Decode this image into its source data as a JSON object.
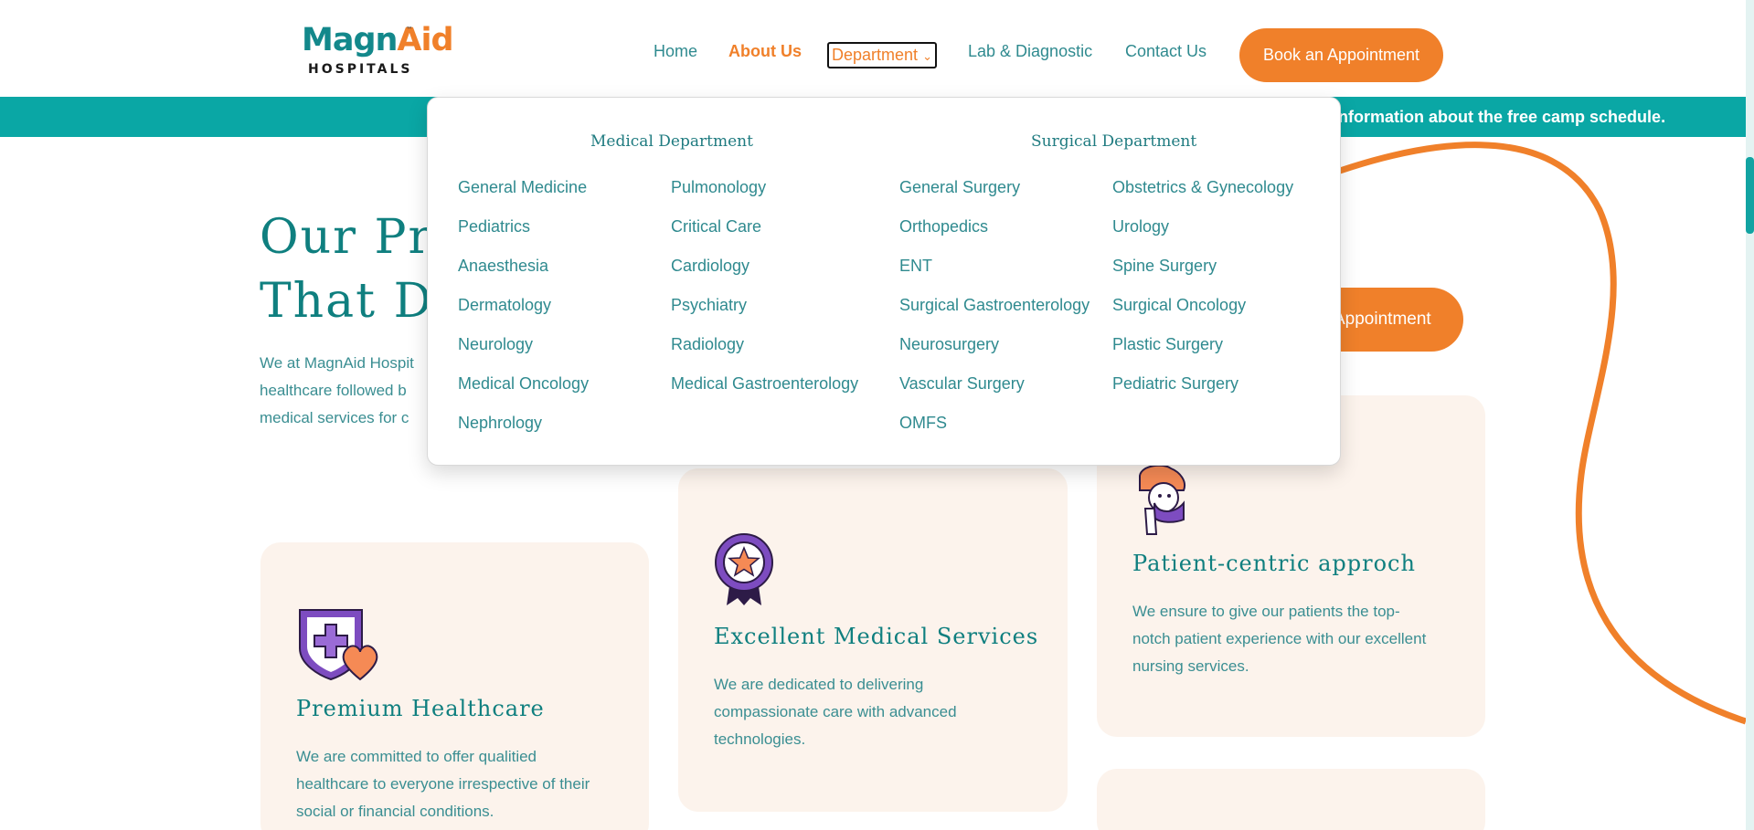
{
  "brand": {
    "name_part1": "Magn",
    "name_part2": "Aid",
    "trademark": "™",
    "subtitle": "HOSPITALS"
  },
  "nav": {
    "home": "Home",
    "about": "About Us",
    "department": "Department",
    "department_caret": "⌄",
    "lab": "Lab & Diagnostic",
    "contact": "Contact Us",
    "book": "Book an Appointment"
  },
  "banner": {
    "text": "r information about the free camp schedule."
  },
  "dropdown": {
    "medical_heading": "Medical Department",
    "surgical_heading": "Surgical Department",
    "medical_col1": [
      "General Medicine",
      "Pediatrics",
      "Anaesthesia",
      "Dermatology",
      "Neurology",
      "Medical Oncology",
      "Nephrology"
    ],
    "medical_col2": [
      "Pulmonology",
      "Critical Care",
      "Cardiology",
      "Psychiatry",
      "Radiology",
      "Medical Gastroenterology"
    ],
    "surgical_col1": [
      "General Surgery",
      "Orthopedics",
      "ENT",
      "Surgical Gastroenterology",
      "Neurosurgery",
      "Vascular Surgery",
      "OMFS"
    ],
    "surgical_col2": [
      "Obstetrics & Gynecology",
      "Urology",
      "Spine Surgery",
      "Surgical Oncology",
      "Plastic Surgery",
      "Pediatric Surgery"
    ]
  },
  "hero": {
    "title_line1": "Our Pri",
    "title_line2": "That De",
    "para_line1": "We at MagnAid Hospit",
    "para_line2": "healthcare followed b",
    "para_line3": "medical services for c",
    "appt_button": "Appointment"
  },
  "cards": [
    {
      "title": "Premium Healthcare",
      "text": "We are committed to offer qualitied healthcare to everyone irrespective of their social or financial conditions.",
      "icon": "shield-heart-icon"
    },
    {
      "title": "Excellent Medical Services",
      "text": "We are dedicated to delivering compassionate care with advanced technologies.",
      "icon": "award-badge-icon"
    },
    {
      "title": "Patient-centric approch",
      "text": "We ensure to give our patients the top-notch patient experience with our excellent nursing services.",
      "icon": "nurse-icon"
    }
  ],
  "colors": {
    "teal": "#0aa7a5",
    "orange": "#f0802a",
    "text": "#2f8a8f",
    "card_bg": "#fcf3ec"
  }
}
